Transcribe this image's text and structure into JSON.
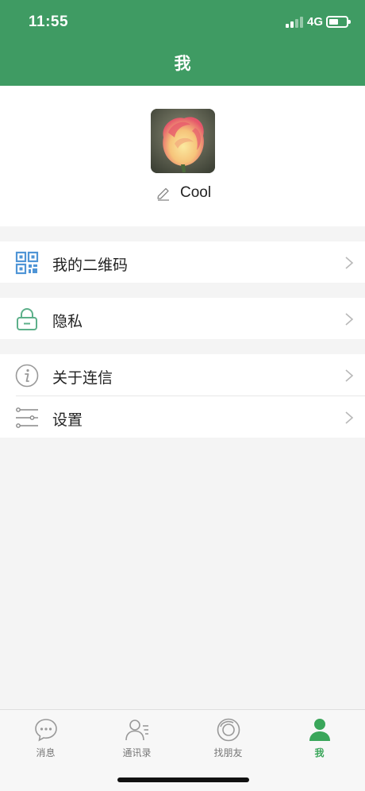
{
  "status_bar": {
    "time": "11:55",
    "network": "4G"
  },
  "header": {
    "title": "我"
  },
  "profile": {
    "username": "Cool",
    "avatar_icon": "rose-photo",
    "edit_icon": "pencil-icon"
  },
  "menu": {
    "qrcode": {
      "label": "我的二维码",
      "icon": "qr-code-icon"
    },
    "privacy": {
      "label": "隐私",
      "icon": "lock-icon"
    },
    "about": {
      "label": "关于连信",
      "icon": "info-icon"
    },
    "settings": {
      "label": "设置",
      "icon": "sliders-icon"
    }
  },
  "tabbar": {
    "messages": {
      "label": "消息",
      "icon": "chat-bubble-icon"
    },
    "contacts": {
      "label": "通讯录",
      "icon": "contacts-icon"
    },
    "discover": {
      "label": "找朋友",
      "icon": "discover-icon"
    },
    "me": {
      "label": "我",
      "icon": "person-icon",
      "active": true
    }
  },
  "colors": {
    "header_green": "#3f9b63",
    "accent_green": "#3aa65a",
    "qr_blue": "#4f95d6",
    "lock_green": "#5db08a",
    "background": "#f4f4f4"
  }
}
